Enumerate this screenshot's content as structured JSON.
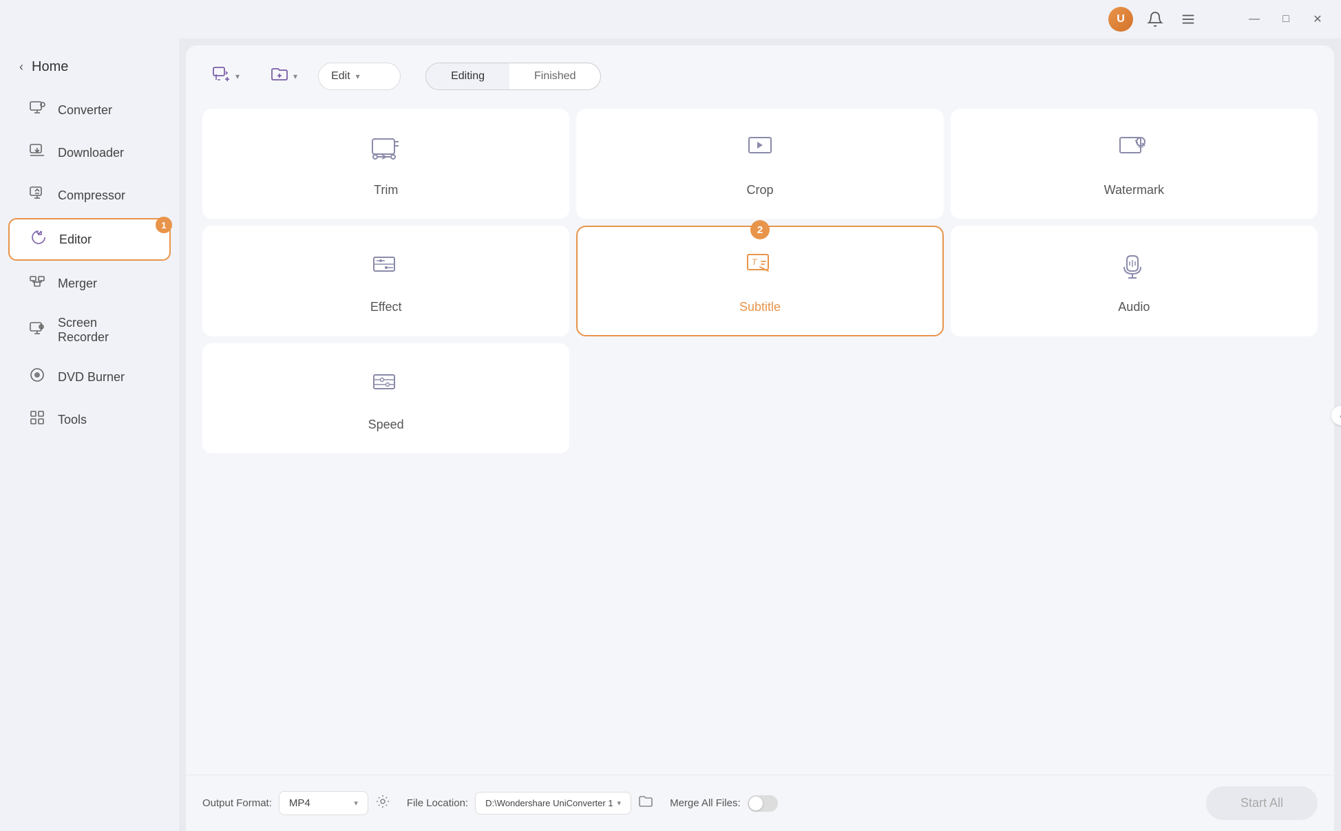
{
  "titlebar": {
    "window_controls": {
      "minimize": "—",
      "maximize": "□",
      "close": "✕"
    }
  },
  "sidebar": {
    "home_label": "Home",
    "back_arrow": "‹",
    "items": [
      {
        "id": "converter",
        "label": "Converter",
        "icon": "converter"
      },
      {
        "id": "downloader",
        "label": "Downloader",
        "icon": "downloader"
      },
      {
        "id": "compressor",
        "label": "Compressor",
        "icon": "compressor"
      },
      {
        "id": "editor",
        "label": "Editor",
        "icon": "editor",
        "active": true,
        "badge": "1"
      },
      {
        "id": "merger",
        "label": "Merger",
        "icon": "merger"
      },
      {
        "id": "screen-recorder",
        "label": "Screen Recorder",
        "icon": "screen-recorder"
      },
      {
        "id": "dvd-burner",
        "label": "DVD Burner",
        "icon": "dvd-burner"
      },
      {
        "id": "tools",
        "label": "Tools",
        "icon": "tools"
      }
    ]
  },
  "toolbar": {
    "add_file_label": "",
    "add_folder_label": "",
    "edit_dropdown_value": "Edit",
    "tab_editing": "Editing",
    "tab_finished": "Finished"
  },
  "grid": {
    "rows": [
      [
        {
          "id": "trim",
          "label": "Trim",
          "icon": "trim",
          "highlighted": false
        },
        {
          "id": "crop",
          "label": "Crop",
          "icon": "crop",
          "highlighted": false
        },
        {
          "id": "watermark",
          "label": "Watermark",
          "icon": "watermark",
          "highlighted": false
        }
      ],
      [
        {
          "id": "effect",
          "label": "Effect",
          "icon": "effect",
          "highlighted": false
        },
        {
          "id": "subtitle",
          "label": "Subtitle",
          "icon": "subtitle",
          "highlighted": true,
          "badge": "2"
        },
        {
          "id": "audio",
          "label": "Audio",
          "icon": "audio",
          "highlighted": false
        }
      ],
      [
        {
          "id": "speed",
          "label": "Speed",
          "icon": "speed",
          "highlighted": false
        },
        null,
        null
      ]
    ]
  },
  "bottom_bar": {
    "output_format_label": "Output Format:",
    "output_format_value": "MP4",
    "file_location_label": "File Location:",
    "file_location_value": "D:\\Wondershare UniConverter 1",
    "merge_label": "Merge All Files:",
    "start_all_label": "Start All",
    "settings_icon": "⚙"
  }
}
